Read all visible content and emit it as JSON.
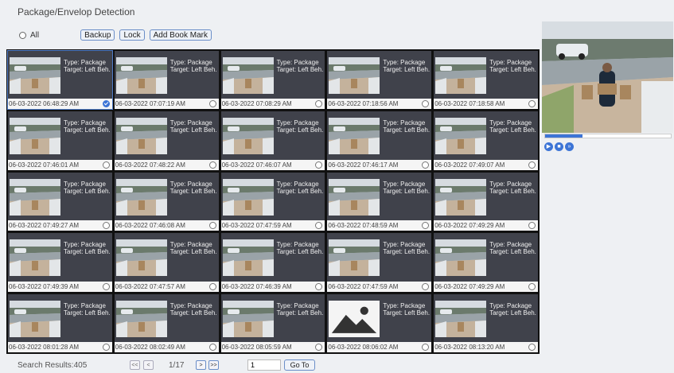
{
  "title": "Package/Envelop Detection",
  "toolbar": {
    "all_label": "All",
    "backup": "Backup",
    "lock": "Lock",
    "bookmark": "Add Book Mark"
  },
  "events": [
    {
      "type": "Type: Package",
      "target": "Target: Left Beh.",
      "time": "06-03-2022 06:48:29 AM",
      "selected": true
    },
    {
      "type": "Type: Package",
      "target": "Target: Left Beh.",
      "time": "06-03-2022 07:07:19 AM",
      "selected": false
    },
    {
      "type": "Type: Package",
      "target": "Target: Left Beh.",
      "time": "06-03-2022 07:08:29 AM",
      "selected": false
    },
    {
      "type": "Type: Package",
      "target": "Target: Left Beh.",
      "time": "06-03-2022 07:18:56 AM",
      "selected": false
    },
    {
      "type": "Type: Package",
      "target": "Target: Left Beh.",
      "time": "06-03-2022 07:18:58 AM",
      "selected": false
    },
    {
      "type": "Type: Package",
      "target": "Target: Left Beh.",
      "time": "06-03-2022 07:46:01 AM",
      "selected": false
    },
    {
      "type": "Type: Package",
      "target": "Target: Left Beh.",
      "time": "06-03-2022 07:48:22 AM",
      "selected": false
    },
    {
      "type": "Type: Package",
      "target": "Target: Left Beh.",
      "time": "06-03-2022 07:46:07 AM",
      "selected": false
    },
    {
      "type": "Type: Package",
      "target": "Target: Left Beh.",
      "time": "06-03-2022 07:46:17 AM",
      "selected": false
    },
    {
      "type": "Type: Package",
      "target": "Target: Left Beh.",
      "time": "06-03-2022 07:49:07 AM",
      "selected": false
    },
    {
      "type": "Type: Package",
      "target": "Target: Left Beh.",
      "time": "06-03-2022 07:49:27 AM",
      "selected": false
    },
    {
      "type": "Type: Package",
      "target": "Target: Left Beh.",
      "time": "06-03-2022 07:46:08 AM",
      "selected": false
    },
    {
      "type": "Type: Package",
      "target": "Target: Left Beh.",
      "time": "06-03-2022 07:47:59 AM",
      "selected": false
    },
    {
      "type": "Type: Package",
      "target": "Target: Left Beh.",
      "time": "06-03-2022 07:48:59 AM",
      "selected": false
    },
    {
      "type": "Type: Package",
      "target": "Target: Left Beh.",
      "time": "06-03-2022 07:49:29 AM",
      "selected": false
    },
    {
      "type": "Type: Package",
      "target": "Target: Left Beh.",
      "time": "06-03-2022 07:49:39 AM",
      "selected": false
    },
    {
      "type": "Type: Package",
      "target": "Target: Left Beh.",
      "time": "06-03-2022 07:47:57 AM",
      "selected": false
    },
    {
      "type": "Type: Package",
      "target": "Target: Left Beh.",
      "time": "06-03-2022 07:46:39 AM",
      "selected": false
    },
    {
      "type": "Type: Package",
      "target": "Target: Left Beh.",
      "time": "06-03-2022 07:47:59 AM",
      "selected": false
    },
    {
      "type": "Type: Package",
      "target": "Target: Left Beh.",
      "time": "06-03-2022 07:49:29 AM",
      "selected": false
    },
    {
      "type": "Type: Package",
      "target": "Target: Left Beh.",
      "time": "06-03-2022 08:01:28 AM",
      "selected": false
    },
    {
      "type": "Type: Package",
      "target": "Target: Left Beh.",
      "time": "06-03-2022 08:02:49 AM",
      "selected": false
    },
    {
      "type": "Type: Package",
      "target": "Target: Left Beh.",
      "time": "06-03-2022 08:05:59 AM",
      "selected": false
    },
    {
      "type": "Type: Package",
      "target": "Target: Left Beh.",
      "time": "06-03-2022 08:06:02 AM",
      "selected": false,
      "placeholder": true
    },
    {
      "type": "Type: Package",
      "target": "Target: Left Beh.",
      "time": "06-03-2022 08:13:20 AM",
      "selected": false
    }
  ],
  "preview": {
    "progress": 0.3
  },
  "footer": {
    "results": "Search Results:405",
    "first": "<<",
    "prev": "<",
    "page": "1/17",
    "next": ">",
    "last": ">>",
    "page_input": "1",
    "goto": "Go To"
  },
  "colors": {
    "accent": "#3c74d6",
    "tile_bg": "#40424b",
    "grid_bg": "#111111"
  }
}
